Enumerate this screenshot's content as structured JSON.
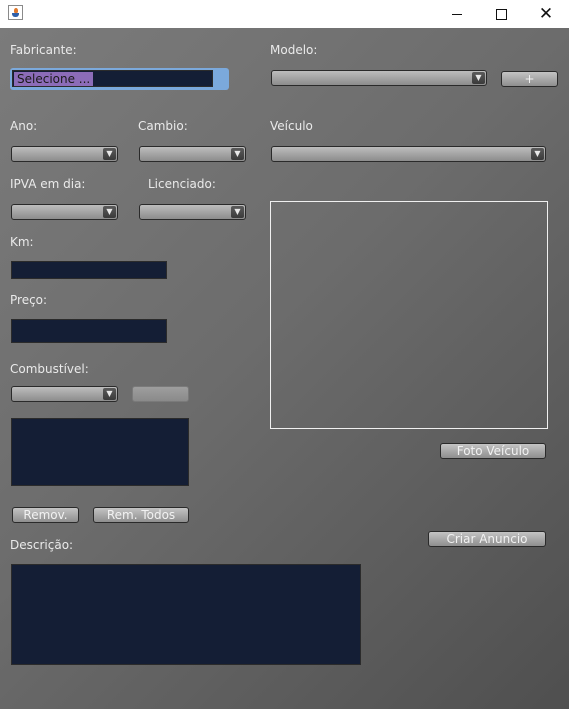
{
  "window": {
    "icon": "java-cup-icon"
  },
  "labels": {
    "fabricante": "Fabricante:",
    "modelo": "Modelo:",
    "ano": "Ano:",
    "cambio": "Cambio:",
    "veiculo": "Veículo",
    "ipva": "IPVA em dia:",
    "licenciado": "Licenciado:",
    "km": "Km:",
    "preco": "Preço:",
    "combustivel": "Combustível:",
    "descricao": "Descrição:"
  },
  "fields": {
    "fabricante_value": "Selecione ..."
  },
  "buttons": {
    "add_modelo": "+",
    "add_combustivel": "",
    "foto_veiculo": "Foto Veículo",
    "remov": "Remov.",
    "rem_todos": "Rem. Todos",
    "criar_anuncio": "Criar Anuncio"
  },
  "colors": {
    "field_bg": "#141e35",
    "selection": "#8c6cb8",
    "focus_border": "#7ba9dc"
  }
}
